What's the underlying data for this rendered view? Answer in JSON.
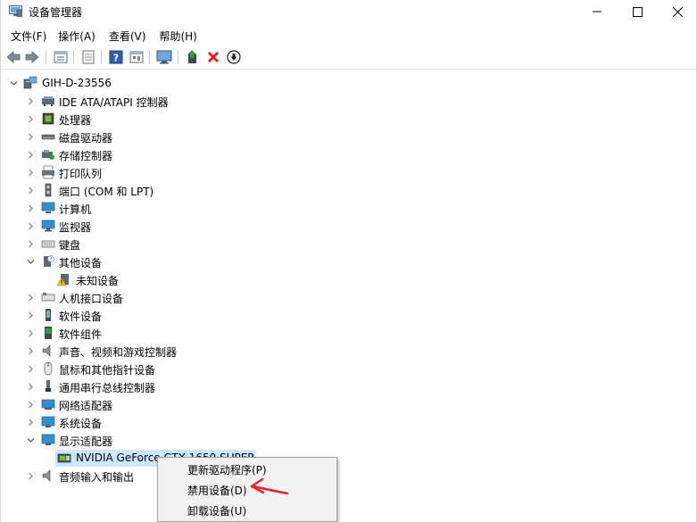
{
  "window": {
    "title": "设备管理器",
    "controls": [
      "minimize",
      "maximize",
      "close"
    ]
  },
  "menubar": [
    {
      "label": "文件(F)"
    },
    {
      "label": "操作(A)"
    },
    {
      "label": "查看(V)"
    },
    {
      "label": "帮助(H)"
    }
  ],
  "toolbar": [
    "back-icon",
    "forward-icon",
    "properties-icon",
    "list-icon",
    "help-icon",
    "resources-icon",
    "monitor-icon",
    "update-driver-icon",
    "uninstall-icon",
    "disable-icon"
  ],
  "tree": {
    "root": "GIH-D-23556",
    "items": [
      {
        "label": "IDE ATA/ATAPI 控制器",
        "icon": "ide-controller-icon"
      },
      {
        "label": "处理器",
        "icon": "processor-icon"
      },
      {
        "label": "磁盘驱动器",
        "icon": "disk-drive-icon"
      },
      {
        "label": "存储控制器",
        "icon": "storage-controller-icon"
      },
      {
        "label": "打印队列",
        "icon": "printer-icon"
      },
      {
        "label": "端口 (COM 和 LPT)",
        "icon": "port-icon"
      },
      {
        "label": "计算机",
        "icon": "computer-icon"
      },
      {
        "label": "监视器",
        "icon": "monitor-icon"
      },
      {
        "label": "键盘",
        "icon": "keyboard-icon"
      },
      {
        "label": "其他设备",
        "icon": "other-devices-icon",
        "expanded": true
      },
      {
        "label": "未知设备",
        "icon": "unknown-device-warning-icon",
        "child": true
      },
      {
        "label": "人机接口设备",
        "icon": "hid-icon"
      },
      {
        "label": "软件设备",
        "icon": "software-device-icon"
      },
      {
        "label": "软件组件",
        "icon": "software-component-icon"
      },
      {
        "label": "声音、视频和游戏控制器",
        "icon": "sound-icon"
      },
      {
        "label": "鼠标和其他指针设备",
        "icon": "mouse-icon"
      },
      {
        "label": "通用串行总线控制器",
        "icon": "usb-icon"
      },
      {
        "label": "网络适配器",
        "icon": "network-adapter-icon"
      },
      {
        "label": "系统设备",
        "icon": "system-device-icon"
      },
      {
        "label": "显示适配器",
        "icon": "display-adapter-icon",
        "expanded": true
      },
      {
        "label": "NVIDIA GeForce GTX 1650 SUPER",
        "icon": "gpu-icon",
        "child": true,
        "selected": true
      },
      {
        "label": "音频输入和输出",
        "icon": "audio-io-icon"
      }
    ]
  },
  "context_menu": {
    "items": [
      {
        "label": "更新驱动程序(P)"
      },
      {
        "label": "禁用设备(D)"
      },
      {
        "label": "卸载设备(U)"
      }
    ]
  },
  "colors": {
    "selection": "#cce8ff",
    "annotation_arrow": "#e8232f",
    "menu_bg": "#f2f2f2"
  }
}
